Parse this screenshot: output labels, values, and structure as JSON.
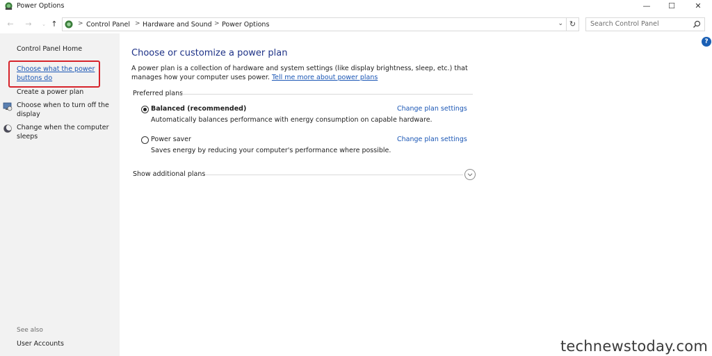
{
  "window": {
    "title": "Power Options",
    "controls": {
      "minimize": "—",
      "maximize": "☐",
      "close": "✕"
    }
  },
  "nav": {
    "back_icon": "back-arrow-icon",
    "forward_icon": "forward-arrow-icon",
    "up_icon": "up-arrow-icon",
    "breadcrumbs": [
      "Control Panel",
      "Hardware and Sound",
      "Power Options"
    ],
    "separator": ">",
    "search": {
      "placeholder": "Search Control Panel",
      "value": ""
    }
  },
  "sidebar": {
    "home": "Control Panel Home",
    "links": [
      {
        "label": "Choose what the power buttons do",
        "active": true,
        "icon": ""
      },
      {
        "label": "Create a power plan",
        "active": false,
        "icon": ""
      },
      {
        "label": "Choose when to turn off the display",
        "active": false,
        "icon": "monitor-icon"
      },
      {
        "label": "Change when the computer sleeps",
        "active": false,
        "icon": "moon-icon"
      }
    ],
    "see_also": "See also",
    "user_accounts": "User Accounts"
  },
  "main": {
    "title": "Choose or customize a power plan",
    "description": "A power plan is a collection of hardware and system settings (like display brightness, sleep, etc.) that manages how your computer uses power.",
    "learn_more": "Tell me more about power plans",
    "preferred_plans_label": "Preferred plans",
    "plans": [
      {
        "name": "Balanced (recommended)",
        "description": "Automatically balances performance with energy consumption on capable hardware.",
        "link": "Change plan settings",
        "selected": true
      },
      {
        "name": "Power saver",
        "description": "Saves energy by reducing your computer's performance where possible.",
        "link": "Change plan settings",
        "selected": false
      }
    ],
    "show_additional": "Show additional plans"
  },
  "watermark": "technewstoday.com",
  "colors": {
    "link": "#1a56b5",
    "title": "#1e3287",
    "highlight": "#d6232a",
    "sidebar_bg": "#f2f2f2"
  }
}
